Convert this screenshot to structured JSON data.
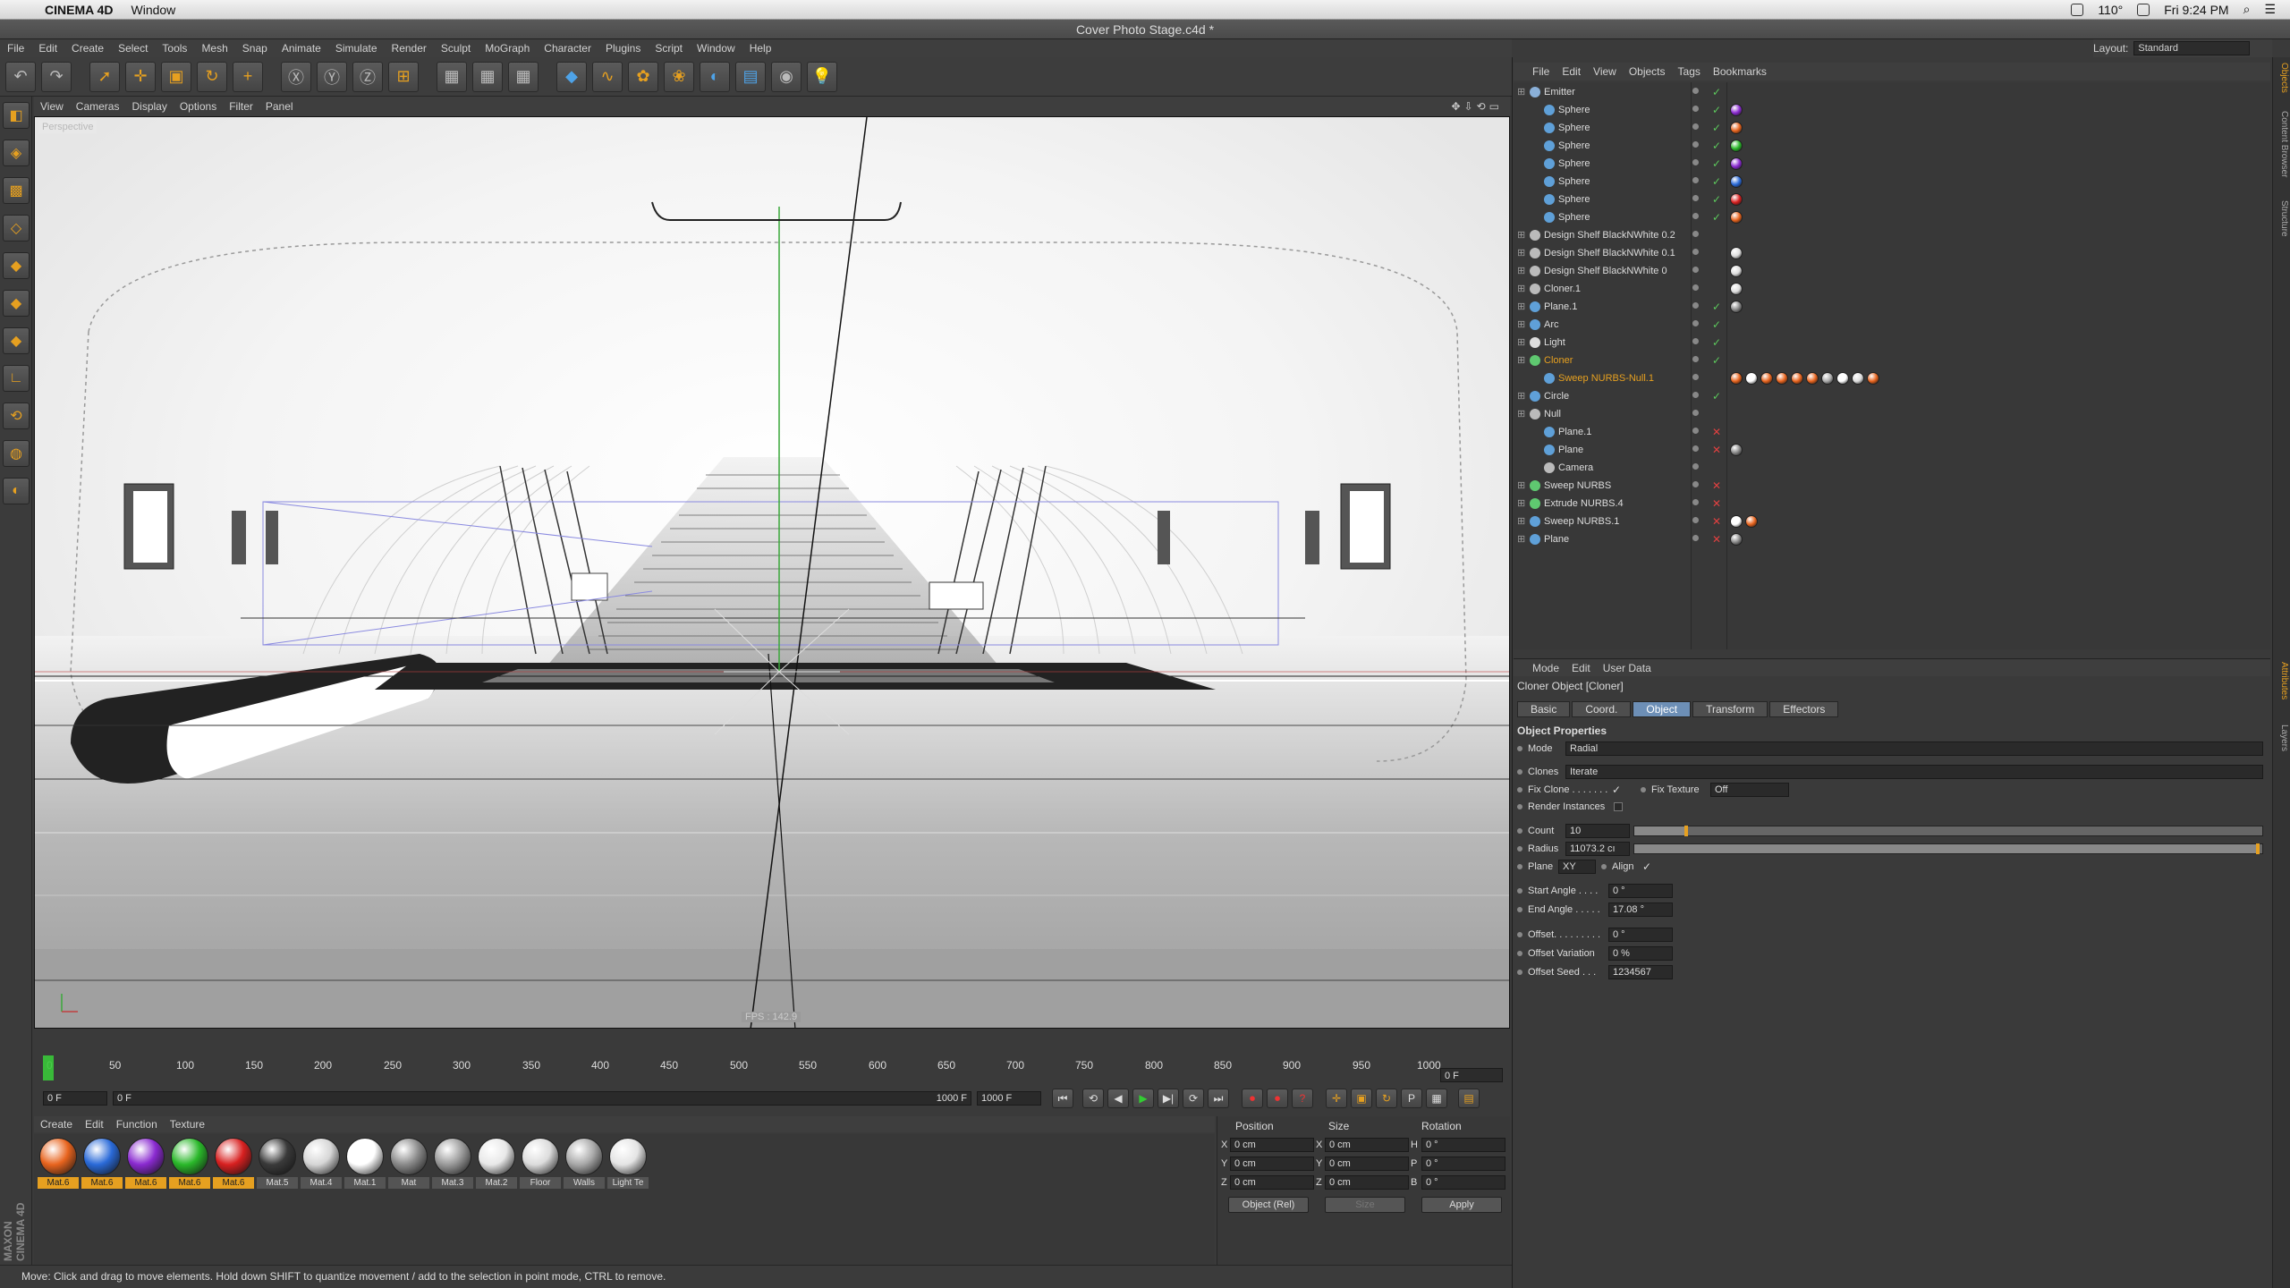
{
  "macbar": {
    "app": "CINEMA 4D",
    "menu": [
      "Window"
    ],
    "battery": "110°",
    "clock": "Fri 9:24 PM"
  },
  "window": {
    "title": "Cover Photo Stage.c4d *"
  },
  "menubar": [
    "File",
    "Edit",
    "Create",
    "Select",
    "Tools",
    "Mesh",
    "Snap",
    "Animate",
    "Simulate",
    "Render",
    "Sculpt",
    "MoGraph",
    "Character",
    "Plugins",
    "Script",
    "Window",
    "Help"
  ],
  "layout": {
    "label": "Layout:",
    "value": "Standard"
  },
  "viewport": {
    "menu": [
      "View",
      "Cameras",
      "Display",
      "Options",
      "Filter",
      "Panel"
    ],
    "label": "Perspective",
    "fps": "FPS : 142.9"
  },
  "timeline": {
    "ticks": [
      "0",
      "50",
      "100",
      "150",
      "200",
      "250",
      "300",
      "350",
      "400",
      "450",
      "500",
      "550",
      "600",
      "650",
      "700",
      "750",
      "800",
      "850",
      "900",
      "950",
      "1000"
    ],
    "current_frame": "0 F",
    "start": "0 F",
    "min": "0 F",
    "max": "1000 F",
    "end": "1000 F"
  },
  "materials": {
    "menu": [
      "Create",
      "Edit",
      "Function",
      "Texture"
    ],
    "items": [
      {
        "name": "Mat.6",
        "color": "#e8641e",
        "selected": true
      },
      {
        "name": "Mat.6",
        "color": "#2a6ad8",
        "selected": true
      },
      {
        "name": "Mat.6",
        "color": "#8a2ad0",
        "selected": true
      },
      {
        "name": "Mat.6",
        "color": "#2ab82a",
        "selected": true
      },
      {
        "name": "Mat.6",
        "color": "#d82020",
        "selected": true
      },
      {
        "name": "Mat.5",
        "color": "#3a3a3a",
        "selected": false
      },
      {
        "name": "Mat.4",
        "color": "#d6d6d6",
        "selected": false
      },
      {
        "name": "Mat.1",
        "color": "#ffffff",
        "selected": false
      },
      {
        "name": "Mat",
        "color": "#8a8a8a",
        "selected": false
      },
      {
        "name": "Mat.3",
        "color": "#9a9a9a",
        "selected": false
      },
      {
        "name": "Mat.2",
        "color": "#e8e8e8",
        "selected": false
      },
      {
        "name": "Floor",
        "color": "#dcdcdc",
        "selected": false
      },
      {
        "name": "Walls",
        "color": "#a8a8a8",
        "selected": false
      },
      {
        "name": "Light Te",
        "color": "#e4e4e4",
        "selected": false
      }
    ]
  },
  "coordinates": {
    "headers": [
      "Position",
      "Size",
      "Rotation"
    ],
    "rows": [
      {
        "axis": "X",
        "pos": "0 cm",
        "size_axis": "X",
        "size": "0 cm",
        "rot_axis": "H",
        "rot": "0 °"
      },
      {
        "axis": "Y",
        "pos": "0 cm",
        "size_axis": "Y",
        "size": "0 cm",
        "rot_axis": "P",
        "rot": "0 °"
      },
      {
        "axis": "Z",
        "pos": "0 cm",
        "size_axis": "Z",
        "size": "0 cm",
        "rot_axis": "B",
        "rot": "0 °"
      }
    ],
    "mode": "Object (Rel)",
    "size_mode": "Size",
    "apply": "Apply"
  },
  "status": "Move: Click and drag to move elements. Hold down SHIFT to quantize movement / add to the selection in point mode, CTRL to remove.",
  "objects": {
    "menu": [
      "File",
      "Edit",
      "View",
      "Objects",
      "Tags",
      "Bookmarks"
    ],
    "items": [
      {
        "name": "Emitter",
        "indent": 0,
        "icon": "#8ab0d8",
        "check": "ok",
        "tags": []
      },
      {
        "name": "Sphere",
        "indent": 1,
        "icon": "#5fa0d8",
        "check": "ok",
        "tags": [
          "#8a2ad0"
        ]
      },
      {
        "name": "Sphere",
        "indent": 1,
        "icon": "#5fa0d8",
        "check": "ok",
        "tags": [
          "#e8641e"
        ]
      },
      {
        "name": "Sphere",
        "indent": 1,
        "icon": "#5fa0d8",
        "check": "ok",
        "tags": [
          "#2ab82a"
        ]
      },
      {
        "name": "Sphere",
        "indent": 1,
        "icon": "#5fa0d8",
        "check": "ok",
        "tags": [
          "#8a2ad0"
        ]
      },
      {
        "name": "Sphere",
        "indent": 1,
        "icon": "#5fa0d8",
        "check": "ok",
        "tags": [
          "#2a6ad8"
        ]
      },
      {
        "name": "Sphere",
        "indent": 1,
        "icon": "#5fa0d8",
        "check": "ok",
        "tags": [
          "#d82020"
        ]
      },
      {
        "name": "Sphere",
        "indent": 1,
        "icon": "#5fa0d8",
        "check": "ok",
        "tags": [
          "#e8641e"
        ]
      },
      {
        "name": "Design Shelf BlackNWhite 0.2",
        "indent": 0,
        "icon": "#bbbbbb",
        "check": "none",
        "tags": []
      },
      {
        "name": "Design Shelf BlackNWhite 0.1",
        "indent": 0,
        "icon": "#bbbbbb",
        "check": "none",
        "tags": [
          "#dddddd"
        ]
      },
      {
        "name": "Design Shelf BlackNWhite 0",
        "indent": 0,
        "icon": "#bbbbbb",
        "check": "none",
        "tags": [
          "#dddddd"
        ]
      },
      {
        "name": "Cloner.1",
        "indent": 0,
        "icon": "#bbbbbb",
        "check": "none",
        "tags": [
          "#dddddd"
        ]
      },
      {
        "name": "Plane.1",
        "indent": 0,
        "icon": "#5fa0d8",
        "check": "ok",
        "tags": [
          "#888888"
        ]
      },
      {
        "name": "Arc",
        "indent": 0,
        "icon": "#5fa0d8",
        "check": "ok",
        "tags": []
      },
      {
        "name": "Light",
        "indent": 0,
        "icon": "#dddddd",
        "check": "ok",
        "tags": []
      },
      {
        "name": "Cloner",
        "indent": 0,
        "icon": "#5fc870",
        "check": "ok",
        "tags": [],
        "selected": true
      },
      {
        "name": "Sweep NURBS-Null.1",
        "indent": 1,
        "icon": "#5fa0d8",
        "check": "none",
        "tags": [
          "#e8641e",
          "#ffffff",
          "#e8641e",
          "#e8641e",
          "#e8641e",
          "#e8641e",
          "#aaaaaa",
          "#ffffff",
          "#dddddd",
          "#e8641e"
        ],
        "selected": true
      },
      {
        "name": "Circle",
        "indent": 0,
        "icon": "#5fa0d8",
        "check": "ok",
        "tags": []
      },
      {
        "name": "Null",
        "indent": 0,
        "icon": "#bbbbbb",
        "check": "none",
        "tags": []
      },
      {
        "name": "Plane.1",
        "indent": 1,
        "icon": "#5fa0d8",
        "check": "x",
        "tags": []
      },
      {
        "name": "Plane",
        "indent": 1,
        "icon": "#5fa0d8",
        "check": "x",
        "tags": [
          "#888888"
        ]
      },
      {
        "name": "Camera",
        "indent": 1,
        "icon": "#bbbbbb",
        "check": "none",
        "tags": []
      },
      {
        "name": "Sweep NURBS",
        "indent": 0,
        "icon": "#5fc870",
        "check": "x",
        "tags": []
      },
      {
        "name": "Extrude NURBS.4",
        "indent": 0,
        "icon": "#5fc870",
        "check": "x",
        "tags": []
      },
      {
        "name": "Sweep NURBS.1",
        "indent": 0,
        "icon": "#5fa0d8",
        "check": "x",
        "tags": [
          "#ffffff",
          "#e8641e"
        ]
      },
      {
        "name": "Plane",
        "indent": 0,
        "icon": "#5fa0d8",
        "check": "x",
        "tags": [
          "#888888"
        ]
      }
    ]
  },
  "attributes": {
    "menu": [
      "Mode",
      "Edit",
      "User Data"
    ],
    "title": "Cloner Object [Cloner]",
    "tabs": [
      "Basic",
      "Coord.",
      "Object",
      "Transform",
      "Effectors"
    ],
    "active_tab": "Object",
    "section": "Object Properties",
    "fields": {
      "mode_label": "Mode",
      "mode": "Radial",
      "clones_label": "Clones",
      "clones": "Iterate",
      "fix_clone_label": "Fix Clone . . . . . . .",
      "fix_texture_label": "Fix Texture",
      "fix_texture": "Off",
      "render_instances_label": "Render Instances",
      "count_label": "Count",
      "count": "10",
      "radius_label": "Radius",
      "radius": "11073.2 cı",
      "plane_label": "Plane",
      "plane": "XY",
      "align_label": "Align",
      "start_angle_label": "Start Angle . . . .",
      "start_angle": "0 °",
      "end_angle_label": "End Angle . . . . .",
      "end_angle": "17.08 °",
      "offset_label": "Offset. . . . . . . . .",
      "offset": "0 °",
      "offset_variation_label": "Offset Variation",
      "offset_variation": "0 %",
      "offset_seed_label": "Offset Seed . . .",
      "offset_seed": "1234567"
    }
  },
  "sidetabs": [
    "Objects",
    "Content Browser",
    "Structure",
    "Attributes",
    "Layers"
  ]
}
